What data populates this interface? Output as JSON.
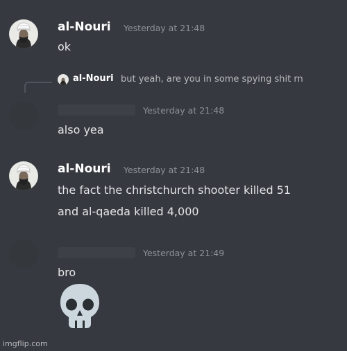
{
  "messages": [
    {
      "author": "al-Nouri",
      "timestamp": "Yesterday at 21:48",
      "lines": [
        "ok"
      ]
    },
    {
      "reply": {
        "author": "al-Nouri",
        "text": "but yeah, are you in some spying shit rn"
      },
      "timestamp": "Yesterday at 21:48",
      "lines": [
        "also yea"
      ]
    },
    {
      "author": "al-Nouri",
      "timestamp": "Yesterday at 21:48",
      "lines": [
        "the fact the christchurch shooter killed 51",
        "and al-qaeda killed 4,000"
      ]
    },
    {
      "timestamp": "Yesterday at 21:49",
      "lines": [
        "bro"
      ],
      "emoji": "skull-icon"
    }
  ],
  "watermark": "imgflip.com",
  "colors": {
    "background": "#36393f",
    "author": "#ffffff",
    "timestamp": "#8e9297",
    "text": "#dcddde"
  }
}
